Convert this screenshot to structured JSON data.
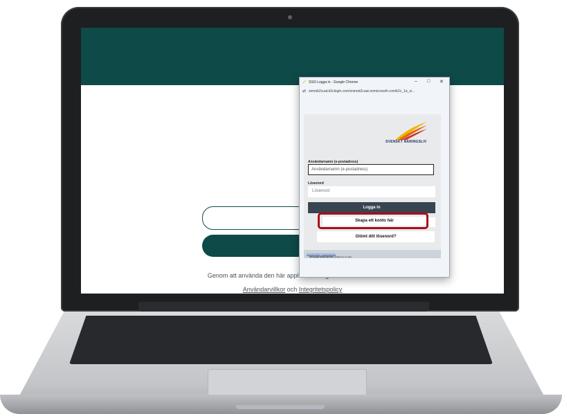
{
  "popup": {
    "window_title": "SSO-Logga in - Google Chrome",
    "url": "snmob2cuat.b2clogin.com/snmob2cuat.onmicrosoft.com/b2c_1a_si...",
    "controls": {
      "minimize": "–",
      "maximize": "□",
      "close": "✕"
    }
  },
  "brand": {
    "name": "SVENSKT NÄRINGSLIV",
    "colors": {
      "swoosh_yellow": "#f3b400",
      "swoosh_orange": "#e2661c",
      "swoosh_red": "#c8352a"
    }
  },
  "form": {
    "username_label": "Användarnamn (e-postadress)",
    "username_placeholder": "Användarnamn (e-postadress)",
    "password_label": "Lösenord",
    "password_placeholder": "Lösenord",
    "login_button": "Logga in",
    "create_account_button": "Skapa ett konto här",
    "forgot_password_button": "Glömt ditt lösenord?",
    "footer": {
      "prefix": "Genom att skapa ett konto godkänner du våra",
      "terms_link": "Användarvillkor",
      "middle": "och trygger att du läst vår",
      "privacy_link": "Integritetspolicy"
    }
  },
  "page": {
    "terms_line1": "Genom att använda den här applikationen godkänner du våra",
    "terms_link": "Användarvillkor",
    "terms_and": "och",
    "privacy_link": "Integritetspolicy",
    "accent_color": "#0e4a47",
    "highlight_color": "#a90d1a"
  }
}
